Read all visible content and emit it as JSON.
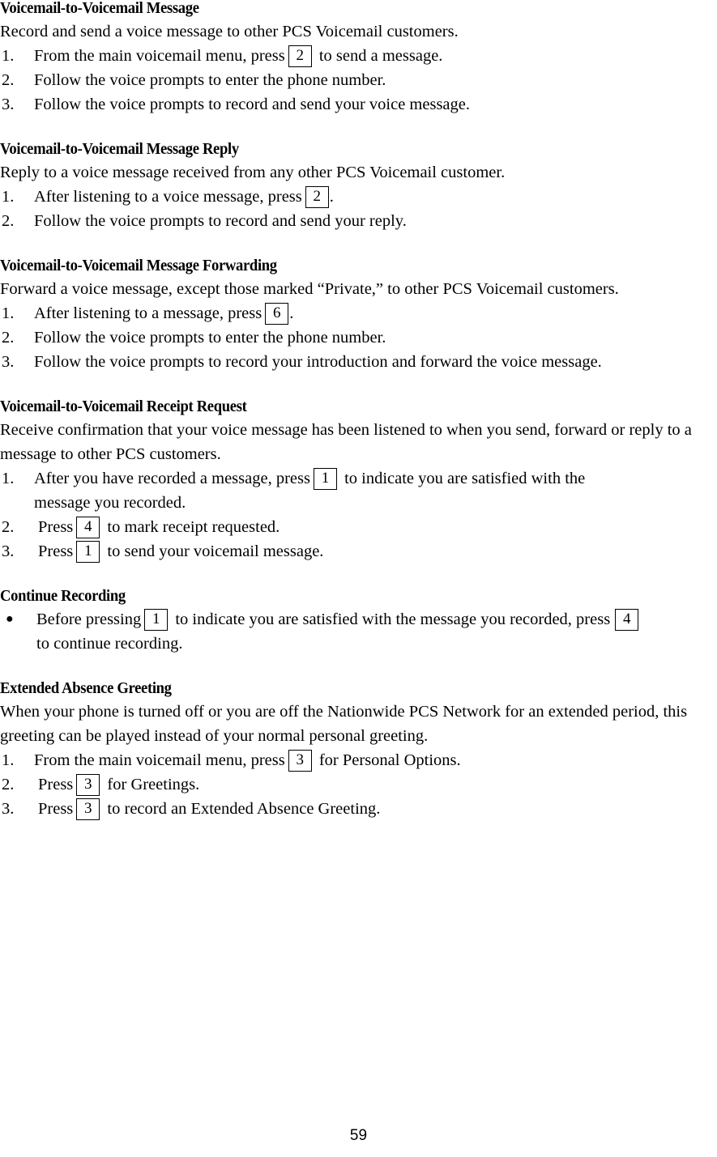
{
  "document": {
    "page_number": "59"
  },
  "sections": [
    {
      "heading": "Voicemail-to-Voicemail Message",
      "intro": "Record and send a voice message to other PCS Voicemail customers.",
      "steps": [
        {
          "marker": "1.",
          "text_before": "From the main voicemail menu, press",
          "key": "2",
          "text_after": "to send a message."
        },
        {
          "marker": "2.",
          "text_before": "Follow the voice prompts to enter the phone number.",
          "key": "",
          "text_after": ""
        },
        {
          "marker": "3.",
          "text_before": "Follow the voice prompts to record and send your voice message.",
          "key": "",
          "text_after": ""
        }
      ]
    },
    {
      "heading": "Voicemail-to-Voicemail Message Reply",
      "intro": "Reply to a voice message received from any other PCS Voicemail customer.",
      "steps": [
        {
          "marker": "1.",
          "text_before": "After listening to a voice message, press",
          "key": "2",
          "text_after": "."
        },
        {
          "marker": "2.",
          "text_before": "Follow the voice prompts to record and send your reply.",
          "key": "",
          "text_after": ""
        }
      ]
    },
    {
      "heading": "Voicemail-to-Voicemail Message Forwarding",
      "intro": "Forward a voice message, except those marked “Private,” to other PCS Voicemail customers.",
      "steps": [
        {
          "marker": "1.",
          "text_before": "After listening to a message, press",
          "key": "6",
          "text_after": "."
        },
        {
          "marker": "2.",
          "text_before": "Follow the voice prompts to enter the phone number.",
          "key": "",
          "text_after": ""
        },
        {
          "marker": "3.",
          "text_before": "Follow the voice prompts to record your introduction and forward the voice message.",
          "key": "",
          "text_after": ""
        }
      ]
    },
    {
      "heading": "Voicemail-to-Voicemail Receipt Request",
      "intro": "Receive confirmation that your voice message has been listened to when you send, forward or reply to a message to other PCS customers.",
      "steps": [
        {
          "marker": "1.",
          "text_before": "After you have recorded a message, press",
          "key": "1",
          "text_after": "to indicate you are satisfied with the",
          "continuation": "message you recorded."
        },
        {
          "marker": "2.",
          "text_before": "Press",
          "key": "4",
          "text_after": "to mark receipt requested."
        },
        {
          "marker": "3.",
          "text_before": "Press",
          "key": "1",
          "text_after": "to send your voicemail message."
        }
      ]
    },
    {
      "heading": "Continue Recording",
      "intro": "",
      "steps": [
        {
          "marker": "●",
          "text_before": "Before pressing",
          "key": "1",
          "text_after": "to indicate you are satisfied with the message you recorded, press",
          "key_end": "4",
          "continuation": "to continue recording."
        }
      ]
    },
    {
      "heading": "Extended Absence Greeting",
      "intro": "When your phone is turned off or you are off the Nationwide PCS Network for an extended period, this greeting can be played instead of your normal personal greeting.",
      "steps": [
        {
          "marker": "1.",
          "text_before": "From the main voicemail menu, press",
          "key": "3",
          "text_after": "for Personal Options."
        },
        {
          "marker": "2.",
          "text_before": "Press",
          "key": "3",
          "text_after": "for Greetings."
        },
        {
          "marker": "3.",
          "text_before": "Press",
          "key": "3",
          "text_after": "to record an Extended Absence Greeting."
        }
      ]
    }
  ]
}
